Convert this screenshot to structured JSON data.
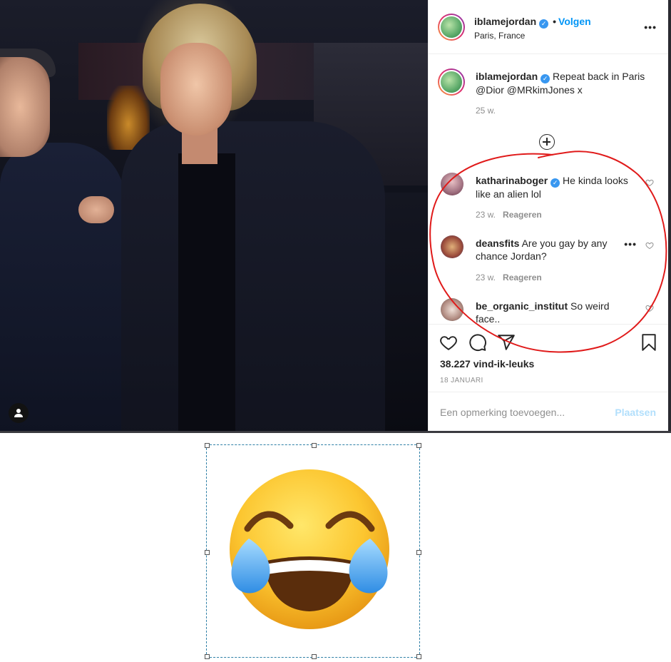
{
  "post": {
    "username": "iblamejordan",
    "follow_label": "Volgen",
    "location": "Paris, France",
    "more_label": "•••",
    "caption_text": "Repeat back in Paris @Dior @MRkimJones x",
    "caption_time": "25 w.",
    "likes": "38.227 vind-ik-leuks",
    "date": "18 JANUARI"
  },
  "comments": [
    {
      "username": "katharinaboger",
      "verified": true,
      "text": "He kinda looks like an alien lol",
      "time": "23 w.",
      "reply_label": "Reageren"
    },
    {
      "username": "deansfits",
      "verified": false,
      "text": "Are you gay by any chance Jordan?",
      "time": "23 w.",
      "reply_label": "Reageren"
    },
    {
      "username": "be_organic_institut",
      "verified": false,
      "text": "So weird face..",
      "time": "",
      "reply_label": ""
    }
  ],
  "add_comment": {
    "placeholder": "Een opmerking toevoegen...",
    "post_label": "Plaatsen"
  },
  "icons": {
    "like": "heart-icon",
    "comment": "comment-icon",
    "share": "share-icon",
    "save": "bookmark-icon",
    "load_more": "plus-circle-icon",
    "tag": "user-tag-icon",
    "emoji": "face-with-tears-of-joy"
  },
  "colors": {
    "link_blue": "#0095f6",
    "annotation_red": "#e01a1a",
    "post_disabled": "#b2dffc",
    "muted": "#8e8e8e"
  }
}
